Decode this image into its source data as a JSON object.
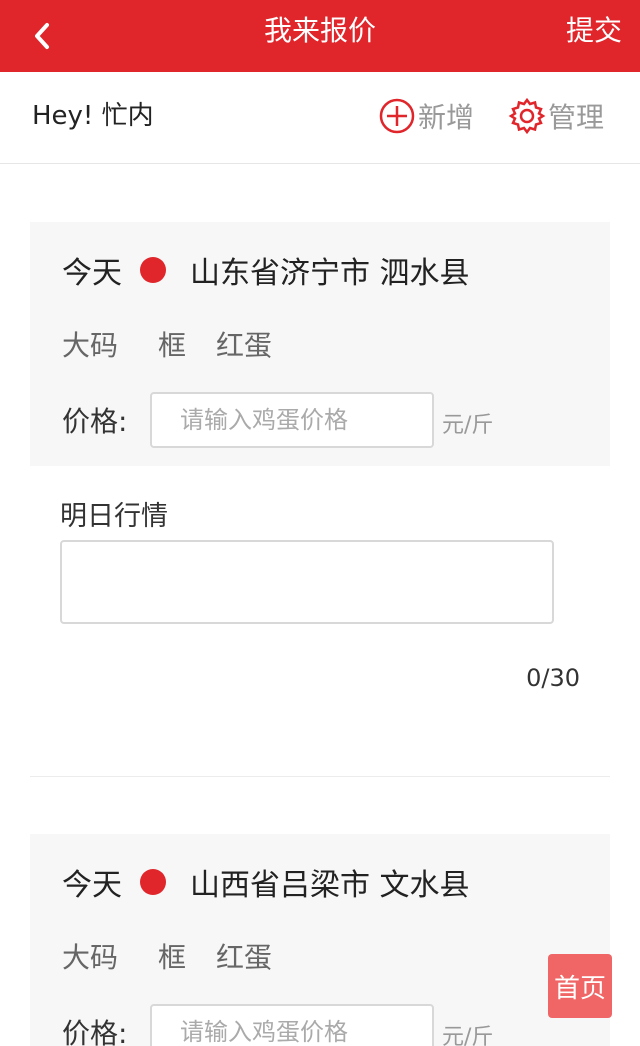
{
  "header": {
    "title": "我来报价",
    "submit_label": "提交"
  },
  "subbar": {
    "greeting": "Hey! 忙内",
    "add_label": "新增",
    "manage_label": "管理"
  },
  "cards": [
    {
      "day": "今天",
      "location": "山东省济宁市 泗水县",
      "size": "大码",
      "pack": "框",
      "egg": "红蛋",
      "price_label": "价格:",
      "price_placeholder": "请输入鸡蛋价格",
      "unit": "元/斤"
    },
    {
      "day": "今天",
      "location": "山西省吕梁市 文水县",
      "size": "大码",
      "pack": "框",
      "egg": "红蛋",
      "price_label": "价格:",
      "price_placeholder": "请输入鸡蛋价格",
      "unit": "元/斤"
    }
  ],
  "tomorrow": {
    "label": "明日行情",
    "counter": "0/30"
  },
  "home_button": "首页",
  "colors": {
    "primary": "#e0252b",
    "home_button": "#f06666"
  }
}
